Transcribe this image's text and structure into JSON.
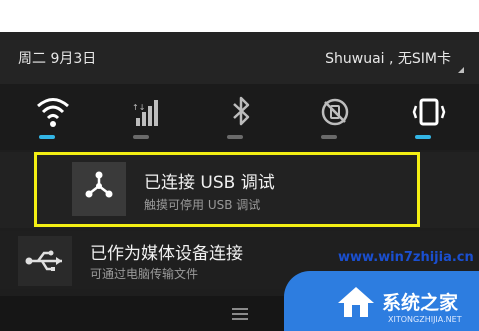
{
  "status": {
    "date": "周二  9月3日",
    "carrier": "Shuwuai , 无SIM卡"
  },
  "quick_settings": [
    {
      "icon": "wifi-icon",
      "active": true
    },
    {
      "icon": "signal-bars-icon",
      "active": false
    },
    {
      "icon": "bluetooth-icon",
      "active": false
    },
    {
      "icon": "auto-rotate-off-icon",
      "active": false
    },
    {
      "icon": "vibrate-icon",
      "active": true
    }
  ],
  "notifications": [
    {
      "icon": "usb-debug-icon",
      "title": "已连接 USB 调试",
      "subtitle": "触摸可停用 USB 调试",
      "highlighted": true
    },
    {
      "icon": "usb-icon",
      "title": "已作为媒体设备连接",
      "subtitle": "可通过电脑传输文件",
      "highlighted": false
    }
  ],
  "watermark": {
    "url": "www.win7zhijia.cn",
    "brand": "系统之家",
    "domain": "XITONGZHIJIA.NET"
  },
  "colors": {
    "highlight_border": "#f4ef14",
    "indicator_active": "#33b5e5",
    "indicator_inactive": "#6a6a6a",
    "watermark_blue": "#2d7de0"
  }
}
